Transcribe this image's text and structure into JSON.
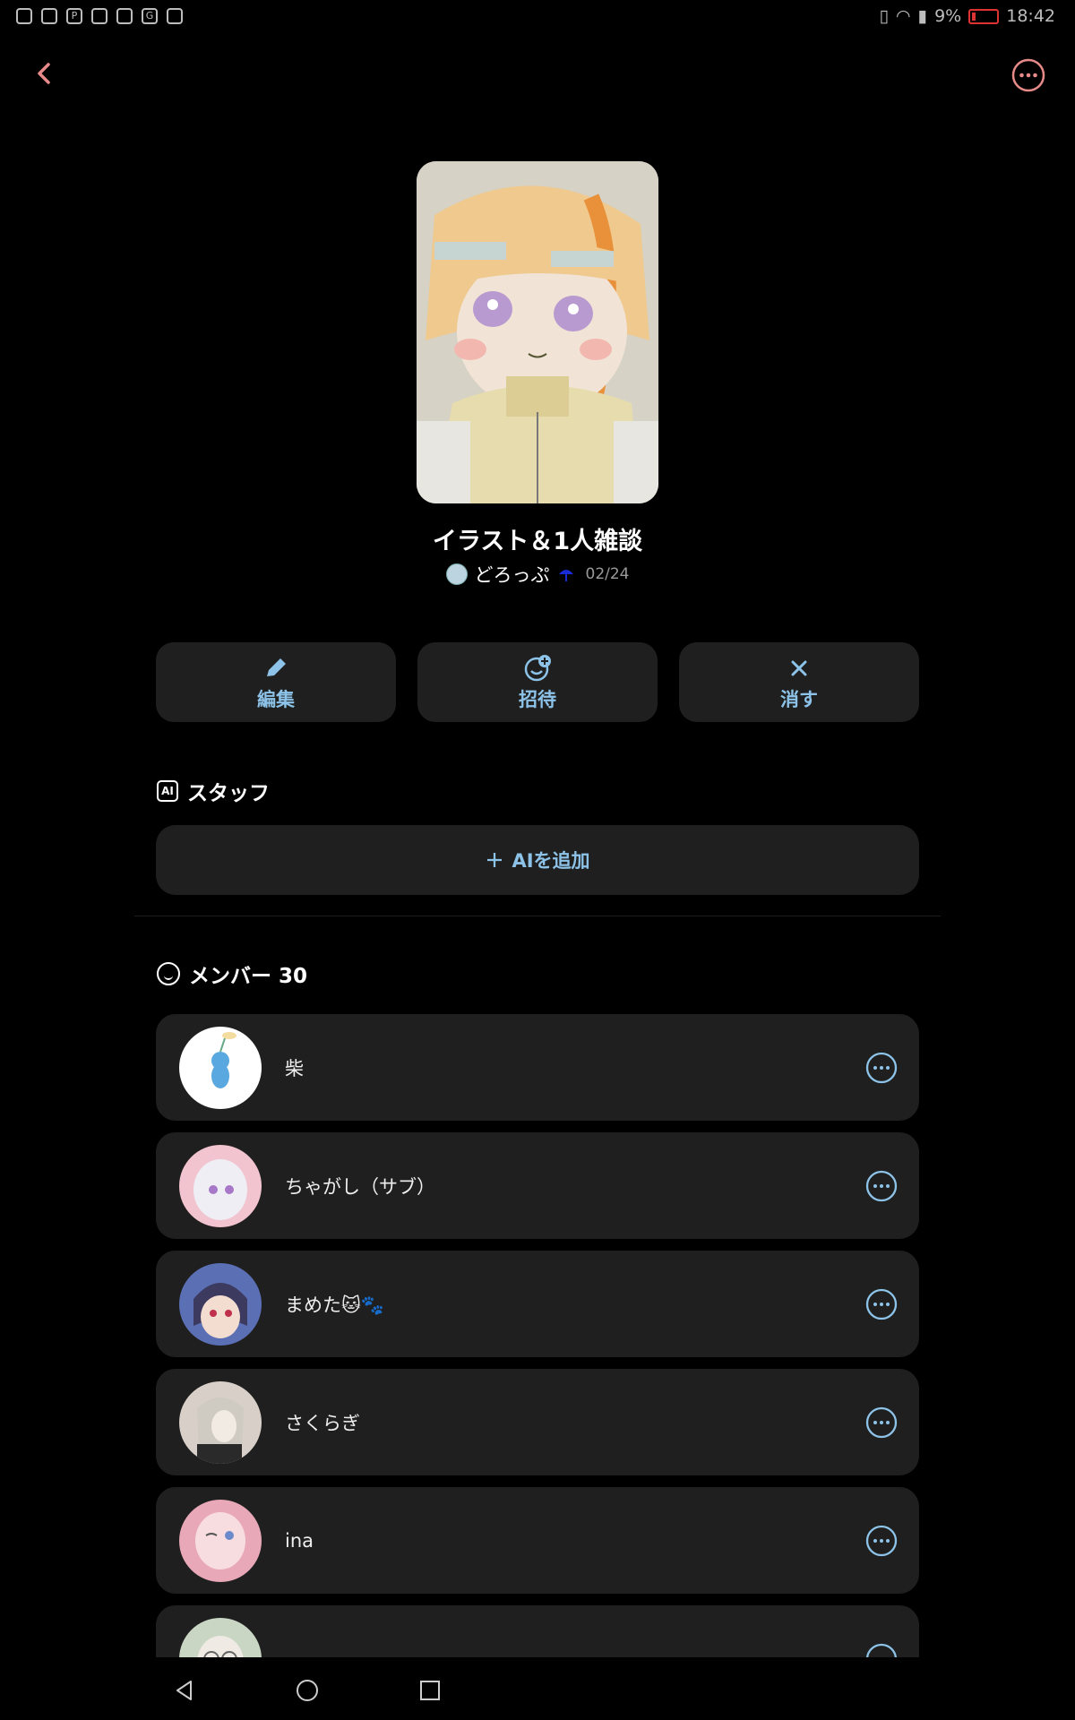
{
  "status_bar": {
    "battery": "9%",
    "time": "18:42"
  },
  "room": {
    "title": "イラスト＆1人雑談",
    "host_name": "どろっぷ",
    "date": "02/24"
  },
  "actions": [
    {
      "label": "編集",
      "icon": "pencil-icon"
    },
    {
      "label": "招待",
      "icon": "add-smile-icon"
    },
    {
      "label": "消す",
      "icon": "close-icon"
    }
  ],
  "staff_section": {
    "icon": "ai-badge-icon",
    "title": "スタッフ",
    "add_label": "AIを追加"
  },
  "members_section": {
    "title": "メンバー 30"
  },
  "members": [
    {
      "name": "柴",
      "avatar_bg": "#ffffff"
    },
    {
      "name": "ちゃがし（サブ）",
      "avatar_bg": "#f2c4cf"
    },
    {
      "name": "まめた🐱🐾",
      "avatar_bg": "#5b6fb5"
    },
    {
      "name": "さくらぎ",
      "avatar_bg": "#d8d0c8"
    },
    {
      "name": "ina",
      "avatar_bg": "#e8a8b8"
    },
    {
      "name": "",
      "avatar_bg": "#c9d6c4"
    }
  ],
  "colors": {
    "accent_blue": "#8dc3e8",
    "accent_pink": "#e88a8a",
    "card": "#1f1f1f"
  }
}
